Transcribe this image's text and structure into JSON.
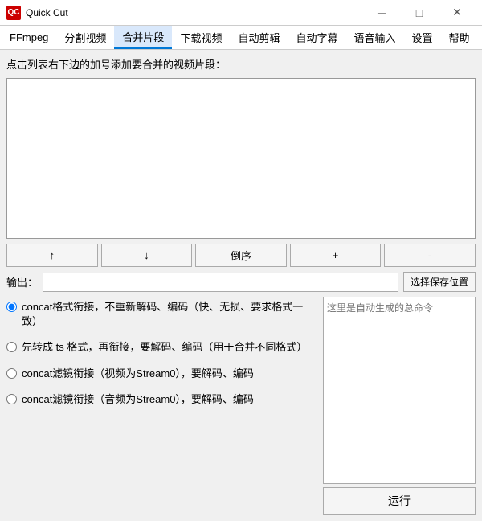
{
  "titleBar": {
    "icon": "QC",
    "title": "Quick Cut",
    "minimize": "─",
    "maximize": "□",
    "close": "✕"
  },
  "menuBar": {
    "items": [
      {
        "label": "FFmpeg",
        "active": false
      },
      {
        "label": "分割视频",
        "active": false
      },
      {
        "label": "合并片段",
        "active": true
      },
      {
        "label": "下载视频",
        "active": false
      },
      {
        "label": "自动剪辑",
        "active": false
      },
      {
        "label": "自动字幕",
        "active": false
      },
      {
        "label": "语音输入",
        "active": false
      },
      {
        "label": "设置",
        "active": false
      },
      {
        "label": "帮助",
        "active": false
      }
    ]
  },
  "main": {
    "instruction": "点击列表右下边的加号添加要合并的视频片段：",
    "buttons": {
      "up": "↑",
      "down": "↓",
      "reverse": "倒序",
      "add": "+",
      "remove": "-"
    },
    "outputLabel": "输出：",
    "outputPlaceholder": "",
    "browseBtn": "选择保存位置",
    "commandPlaceholder": "这里是自动生成的总命令",
    "runBtn": "运行",
    "options": [
      {
        "id": "opt1",
        "checked": true,
        "label": "concat格式衔接，不重新解码、编码（快、无损、要求格式一致）"
      },
      {
        "id": "opt2",
        "checked": false,
        "label": "先转成 ts 格式，再衔接，要解码、编码（用于合并不同格式）"
      },
      {
        "id": "opt3",
        "checked": false,
        "label": "concat滤镜衔接（视频为Stream0），要解码、编码"
      },
      {
        "id": "opt4",
        "checked": false,
        "label": "concat滤镜衔接（音频为Stream0），要解码、编码"
      }
    ]
  }
}
